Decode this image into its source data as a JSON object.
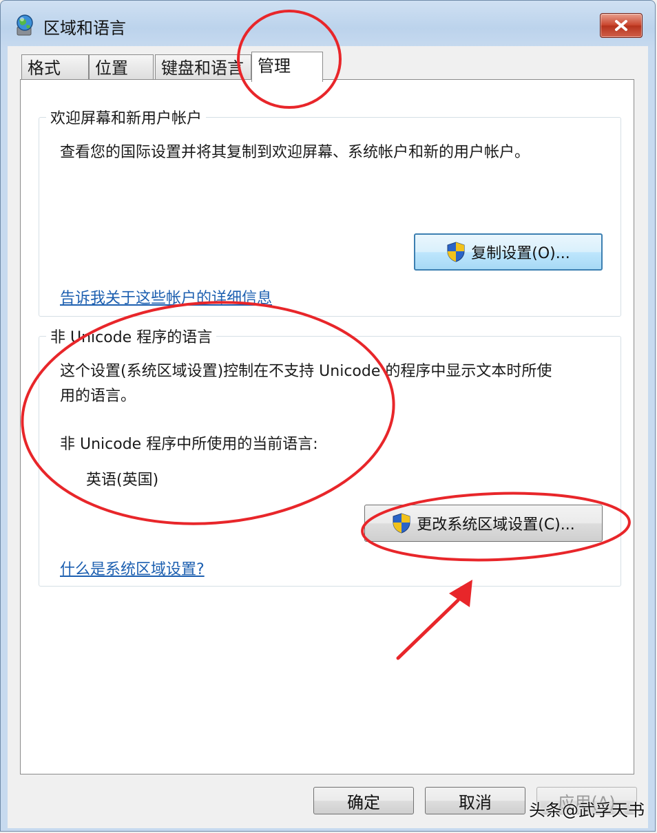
{
  "window": {
    "title": "区域和语言",
    "close_label": "✕"
  },
  "tabs": [
    {
      "label": "格式",
      "active": false
    },
    {
      "label": "位置",
      "active": false
    },
    {
      "label": "键盘和语言",
      "active": false
    },
    {
      "label": "管理",
      "active": true
    }
  ],
  "welcome_group": {
    "title": "欢迎屏幕和新用户帐户",
    "description": "查看您的国际设置并将其复制到欢迎屏幕、系统帐户和新的用户帐户。",
    "copy_button": "复制设置(O)...",
    "link": "告诉我关于这些帐户的详细信息"
  },
  "unicode_group": {
    "title": "非 Unicode 程序的语言",
    "description_line1": "这个设置(系统区域设置)控制在不支持 Unicode 的程序中显示文本时所使",
    "description_line2": "用的语言。",
    "current_label": "非 Unicode 程序中所使用的当前语言:",
    "current_value": "英语(英国)",
    "change_button": "更改系统区域设置(C)...",
    "link": "什么是系统区域设置?"
  },
  "footer": {
    "ok": "确定",
    "cancel": "取消",
    "apply": "应用(A)"
  },
  "watermark": "头条@武孚天书",
  "icons": {
    "app": "globe-monitor-icon",
    "shield": "uac-shield-icon",
    "close": "close-icon"
  },
  "annotation_color": "#e8262a"
}
